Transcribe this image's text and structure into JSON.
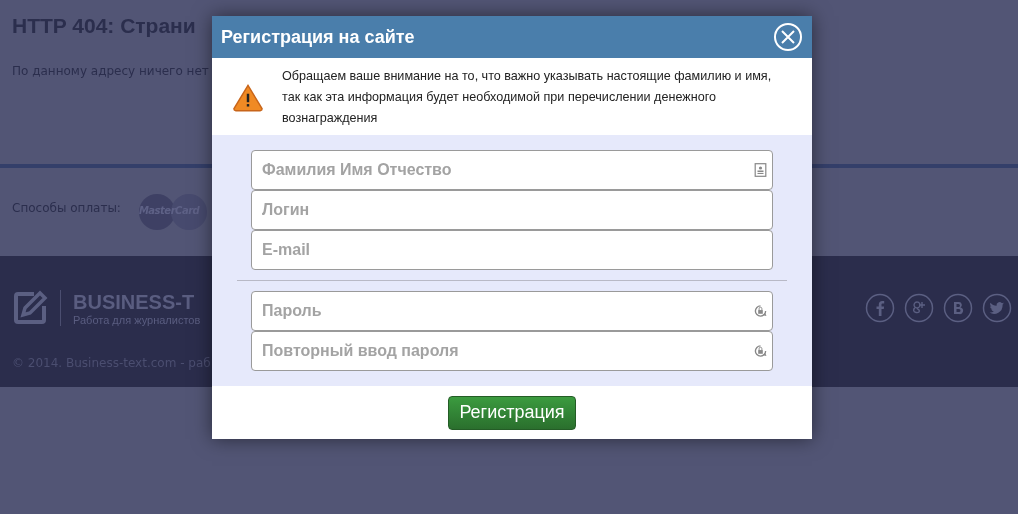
{
  "page": {
    "title": "HTTP 404: Страни",
    "message": "По данному адресу ничего нет",
    "payment_label": "Способы оплаты:",
    "payment_logo": "MasterCard",
    "brand_name": "BUSINESS-T",
    "brand_tagline": "Работа для журналистов",
    "copyright": "© 2014. Business-text.com - раб",
    "social": [
      {
        "kind": "facebook"
      },
      {
        "kind": "googleplus"
      },
      {
        "kind": "vk"
      },
      {
        "kind": "twitter"
      }
    ]
  },
  "dialog": {
    "title": "Регистрация на сайте",
    "notice": "Обращаем ваше внимание на то, что важно указывать настоящие фамилию и имя, так как эта информация будет необходимой при перечислении денежного вознаграждения",
    "field_groups": [
      [
        {
          "placeholder": "Фамилия Имя Отчество",
          "kind": "fullname"
        },
        {
          "placeholder": "Логин",
          "kind": "login"
        },
        {
          "placeholder": "E-mail",
          "kind": "email"
        }
      ],
      [
        {
          "placeholder": "Пароль",
          "kind": "password"
        },
        {
          "placeholder": "Повторный ввод пароля",
          "kind": "password"
        }
      ]
    ],
    "submit": "Регистрация"
  }
}
